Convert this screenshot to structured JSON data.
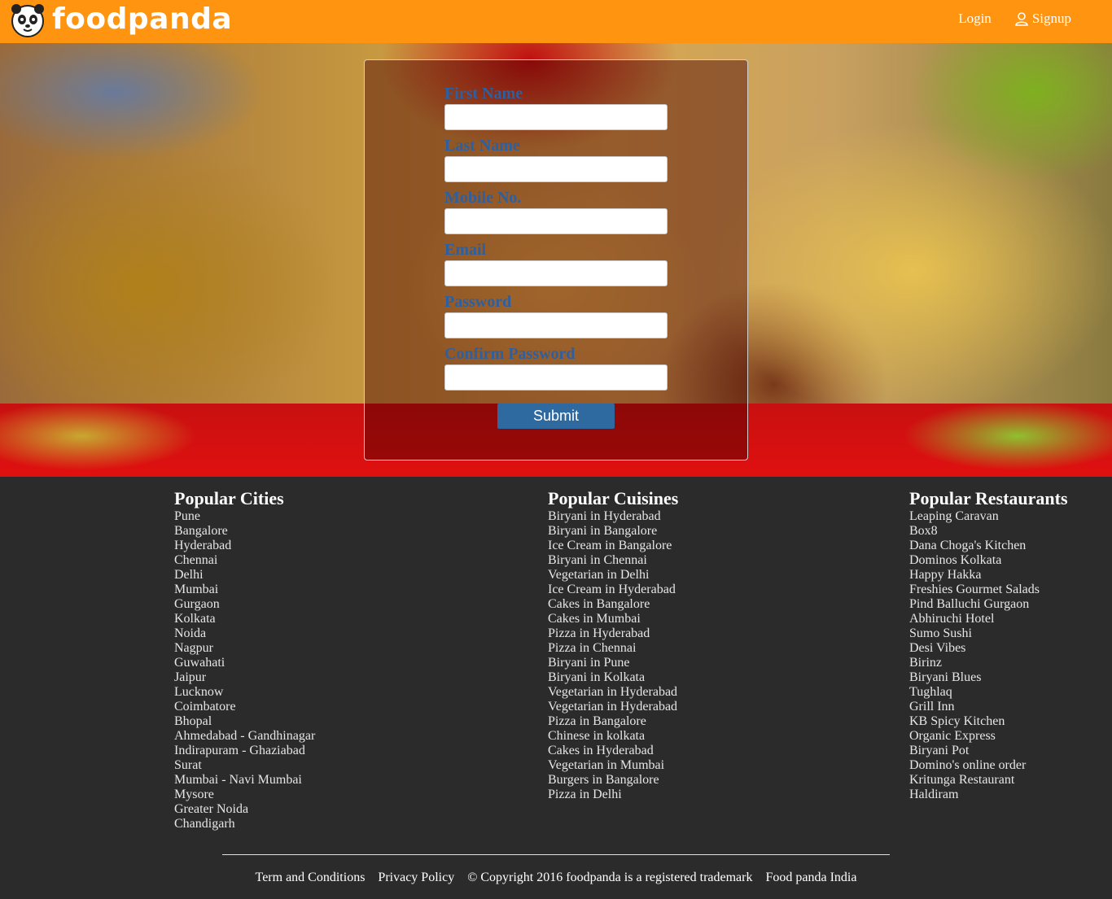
{
  "header": {
    "brand": "foodpanda",
    "nav": {
      "login": "Login",
      "signup": "Signup"
    }
  },
  "colors": {
    "header_bg": "#ff9410",
    "label": "#2e5f9e",
    "button": "#2e6aa0",
    "footer_bg": "#2b2b2b"
  },
  "form": {
    "fields": [
      {
        "label": "First Name",
        "value": ""
      },
      {
        "label": "Last Name",
        "value": ""
      },
      {
        "label": "Mobile No.",
        "value": ""
      },
      {
        "label": "Email",
        "value": ""
      },
      {
        "label": "Password",
        "value": ""
      },
      {
        "label": "Confirm Password",
        "value": ""
      }
    ],
    "submit_label": "Submit"
  },
  "footer": {
    "cities": {
      "title": "Popular Cities",
      "items": [
        "Pune",
        "Bangalore",
        "Hyderabad",
        "Chennai",
        "Delhi",
        "Mumbai",
        "Gurgaon",
        "Kolkata",
        "Noida",
        "Nagpur",
        "Guwahati",
        "Jaipur",
        "Lucknow",
        "Coimbatore",
        "Bhopal",
        "Ahmedabad - Gandhinagar",
        "Indirapuram - Ghaziabad",
        "Surat",
        "Mumbai - Navi Mumbai",
        "Mysore",
        "Greater Noida",
        "Chandigarh"
      ]
    },
    "cuisines": {
      "title": "Popular Cuisines",
      "items": [
        "Biryani in Hyderabad",
        "Biryani in Bangalore",
        "Ice Cream in Bangalore",
        "Biryani in Chennai",
        "Vegetarian in Delhi",
        "Ice Cream in Hyderabad",
        "Cakes in Bangalore",
        "Cakes in Mumbai",
        "Pizza in Hyderabad",
        "Pizza in Chennai",
        "Biryani in Pune",
        "Biryani in Kolkata",
        "Vegetarian in Hyderabad",
        "Vegetarian in Hyderabad",
        "Pizza in Bangalore",
        "Chinese in kolkata",
        "Cakes in Hyderabad",
        "Vegetarian in Mumbai",
        "Burgers in Bangalore",
        "Pizza in Delhi"
      ]
    },
    "restaurants": {
      "title": "Popular Restaurants",
      "items": [
        "Leaping Caravan",
        "Box8",
        "Dana Choga's Kitchen",
        "Dominos Kolkata",
        "Happy Hakka",
        "Freshies Gourmet Salads",
        "Pind Balluchi Gurgaon",
        "Abhiruchi Hotel",
        "Sumo Sushi",
        "Desi Vibes",
        "Birinz",
        "Biryani Blues",
        "Tughlaq",
        "Grill Inn",
        "KB Spicy Kitchen",
        "Organic Express",
        "Biryani Pot",
        "Domino's online order",
        "Kritunga Restaurant",
        "Haldiram"
      ]
    },
    "bottom_links": [
      "Term and Conditions",
      "Privacy Policy",
      "© Copyright 2016 foodpanda is a registered trademark",
      "Food panda India"
    ]
  }
}
